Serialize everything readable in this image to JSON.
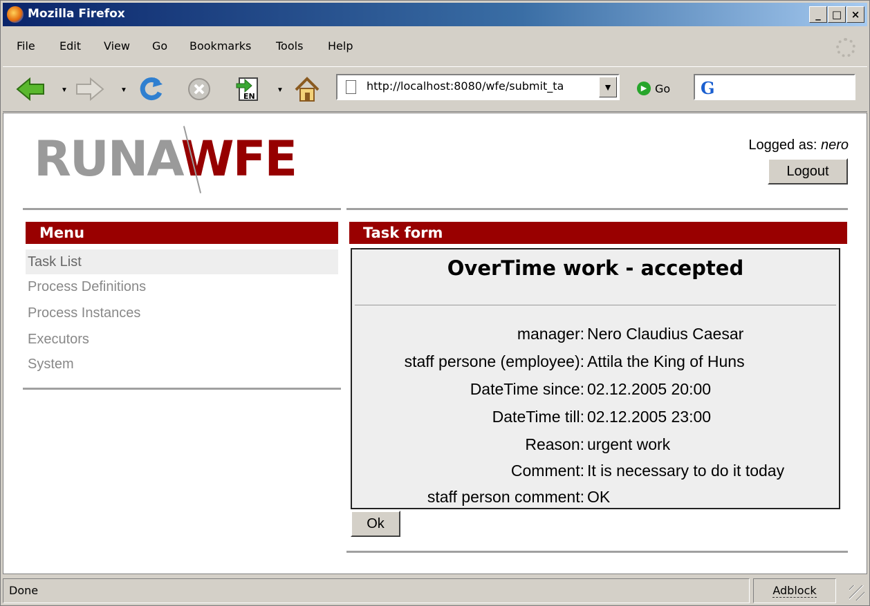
{
  "window": {
    "title": "Mozilla Firefox",
    "minimize": "_",
    "maximize": "□",
    "close": "×"
  },
  "menubar": {
    "items": [
      "File",
      "Edit",
      "View",
      "Go",
      "Bookmarks",
      "Tools",
      "Help"
    ]
  },
  "toolbar": {
    "url": "http://localhost:8080/wfe/submit_ta",
    "go_label": "Go",
    "lang_badge": "EN"
  },
  "page": {
    "logo_left": "RUNA",
    "logo_right": "WFE",
    "logged_as_label": "Logged as:",
    "logged_as_user": "nero",
    "logout_label": "Logout",
    "menu_header": "Menu",
    "menu_items": [
      "Task List",
      "Process Definitions",
      "Process Instances",
      "Executors",
      "System"
    ],
    "task_header": "Task form",
    "task_title": "OverTime work - accepted",
    "fields": [
      {
        "label": "manager:",
        "value": "Nero Claudius Caesar"
      },
      {
        "label": "staff persone (employee):",
        "value": "Attila the King of Huns"
      },
      {
        "label": "DateTime since:",
        "value": "02.12.2005 20:00"
      },
      {
        "label": "DateTime till:",
        "value": "02.12.2005 23:00"
      },
      {
        "label": "Reason:",
        "value": "urgent work"
      },
      {
        "label": "Comment:",
        "value": "It is necessary to do it today"
      },
      {
        "label": "staff person comment:",
        "value": "OK"
      }
    ],
    "ok_label": "Ok"
  },
  "statusbar": {
    "status": "Done",
    "adblock": "Adblock"
  },
  "colors": {
    "accent": "#990000",
    "logo_gray": "#9a9a9a",
    "titlebar": "#0a246a"
  }
}
